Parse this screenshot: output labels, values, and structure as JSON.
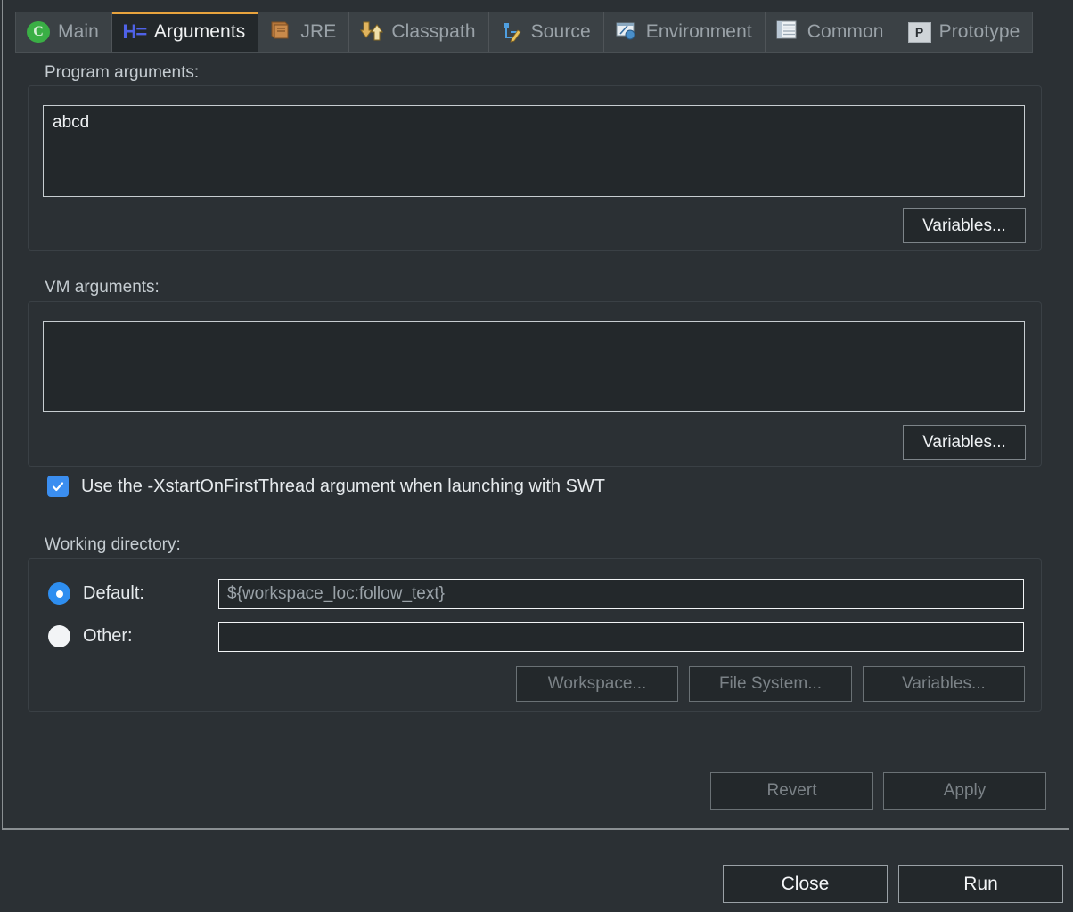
{
  "tabs": [
    {
      "id": "main",
      "label": "Main",
      "icon": "java-class-icon",
      "active": false
    },
    {
      "id": "arguments",
      "label": "Arguments",
      "icon": "arguments-icon",
      "active": true
    },
    {
      "id": "jre",
      "label": "JRE",
      "icon": "book-icon",
      "active": false
    },
    {
      "id": "classpath",
      "label": "Classpath",
      "icon": "arrows-icon",
      "active": false
    },
    {
      "id": "source",
      "label": "Source",
      "icon": "source-pencil-icon",
      "active": false
    },
    {
      "id": "environment",
      "label": "Environment",
      "icon": "environment-icon",
      "active": false
    },
    {
      "id": "common",
      "label": "Common",
      "icon": "lined-sheet-icon",
      "active": false
    },
    {
      "id": "prototype",
      "label": "Prototype",
      "icon": "prototype-icon",
      "active": false
    }
  ],
  "program_arguments": {
    "label": "Program arguments:",
    "value": "abcd",
    "variables_button": "Variables..."
  },
  "vm_arguments": {
    "label": "VM arguments:",
    "value": "",
    "variables_button": "Variables..."
  },
  "swt_option": {
    "label": "Use the -XstartOnFirstThread argument when launching with SWT",
    "checked": true
  },
  "working_directory": {
    "label": "Working directory:",
    "default_radio_label": "Default:",
    "other_radio_label": "Other:",
    "selected": "default",
    "default_value": "${workspace_loc:follow_text}",
    "other_value": "",
    "workspace_button": "Workspace...",
    "file_system_button": "File System...",
    "variables_button": "Variables..."
  },
  "form_actions": {
    "revert_label": "Revert",
    "apply_label": "Apply",
    "revert_enabled": false,
    "apply_enabled": false
  },
  "dialog_actions": {
    "close_label": "Close",
    "run_label": "Run"
  },
  "colors": {
    "background": "#2b3034",
    "active_tab_underline": "#e8a33d",
    "accent_blue": "#3b8ef0",
    "text_primary": "#eef1f3",
    "text_muted": "#9aa2a8",
    "field_border": "#f2f4f6"
  }
}
